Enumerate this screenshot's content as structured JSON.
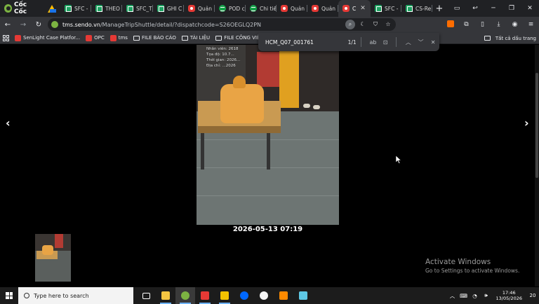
{
  "browser": {
    "brand": "Cốc Cốc",
    "tabs": [
      {
        "label": "SFC -",
        "icon": "sheets-icon",
        "kind": "sheet"
      },
      {
        "label": "THEO",
        "icon": "sheets-icon",
        "kind": "sheet"
      },
      {
        "label": "SFC_T",
        "icon": "sheets-icon",
        "kind": "sheet"
      },
      {
        "label": "GHI C",
        "icon": "sheets-icon",
        "kind": "sheet"
      },
      {
        "label": "Quản",
        "icon": "sendo-icon",
        "kind": "red"
      },
      {
        "label": "POD c",
        "icon": "green-app-icon",
        "kind": "green"
      },
      {
        "label": "Chi tiế",
        "icon": "green-app-icon",
        "kind": "green"
      },
      {
        "label": "Quản",
        "icon": "sendo-icon",
        "kind": "red"
      },
      {
        "label": "Quản",
        "icon": "sendo-icon",
        "kind": "red"
      },
      {
        "label": "C",
        "icon": "sendo-icon",
        "kind": "red",
        "active": true
      },
      {
        "label": "SFC -",
        "icon": "sheets-icon",
        "kind": "sheet"
      },
      {
        "label": "CS-Re",
        "icon": "sheets-icon",
        "kind": "sheet"
      }
    ],
    "new_tab": "+",
    "url_host": "tms.sendo.vn",
    "url_path": "/ManageTripShuttle/detail/?dispatchcode=S26OEGLQ2PN"
  },
  "bookmarks": {
    "items": [
      {
        "label": "SenLight Case Platfor...",
        "icon": "sendo-icon"
      },
      {
        "label": "OPC",
        "icon": "sendo-icon"
      },
      {
        "label": "tms",
        "icon": "sendo-icon"
      },
      {
        "label": "FILE BÁO CÁO",
        "icon": "folder-icon"
      },
      {
        "label": "TÀI LIỆU",
        "icon": "folder-icon"
      },
      {
        "label": "FILE CÔNG VIỆC",
        "icon": "folder-icon"
      }
    ],
    "all_bookmarks": "Tất cả dấu trang"
  },
  "findbar": {
    "query": "HCM_Q07_001761",
    "count": "1/1",
    "match_case": "ab"
  },
  "viewer": {
    "prev_arrow": "‹",
    "next_arrow": "›",
    "photo_stamp": [
      "Nhân viên: 2618",
      "Tọa độ: 10.7...",
      "Thời gian: 2026...",
      "Địa chỉ: ...2026"
    ],
    "caption": "2026-05-13 07:19"
  },
  "activation": {
    "title": "Activate Windows",
    "subtitle": "Go to Settings to activate Windows."
  },
  "taskbar": {
    "search_placeholder": "Type here to search",
    "time": "17:46",
    "date": "13/05/2026",
    "notification_count": "20",
    "apps": [
      {
        "name": "task-view-icon",
        "color": "#1c1c1c"
      },
      {
        "name": "file-explorer-icon",
        "color": "#f4c542"
      },
      {
        "name": "coccoc-taskbar-icon",
        "color": "#7cb342"
      },
      {
        "name": "wps-icon",
        "color": "#e53935"
      },
      {
        "name": "sticky-notes-icon",
        "color": "#f2c200"
      },
      {
        "name": "zalo-icon",
        "color": "#0068ff"
      },
      {
        "name": "chrome-like-icon",
        "color": "#f4f4f4"
      },
      {
        "name": "orange-app-icon",
        "color": "#ff8a00"
      },
      {
        "name": "cyan-app-icon",
        "color": "#5ec8e5"
      }
    ]
  }
}
